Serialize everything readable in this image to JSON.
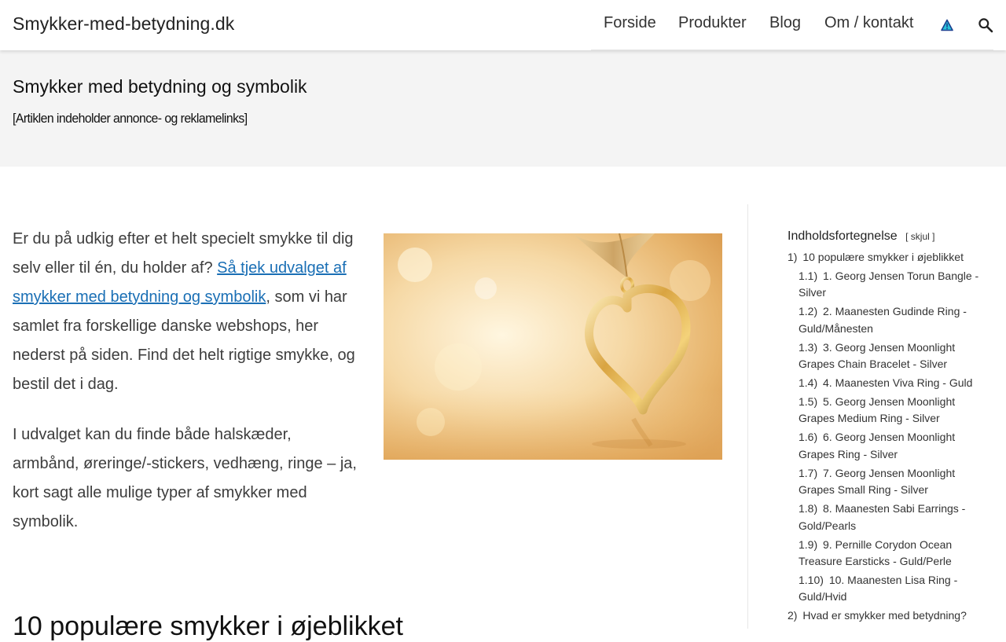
{
  "header": {
    "site_title": "Smykker-med-betydning.dk",
    "nav": [
      {
        "label": "Forside"
      },
      {
        "label": "Produkter"
      },
      {
        "label": "Blog"
      },
      {
        "label": "Om / kontakt"
      }
    ],
    "icons": {
      "warning": "warning-triangle-icon",
      "search": "search-icon"
    }
  },
  "hero": {
    "title": "Smykker med betydning og symbolik",
    "disclaimer": "[Artiklen indeholder annonce- og reklamelinks]"
  },
  "content": {
    "p1_before": "Er du på udkig efter et helt specielt smykke til dig selv eller til én, du holder af? ",
    "p1_link": "Så tjek udvalget af smykker med betydning og symbolik",
    "p1_after": ", som vi har samlet fra forskellige danske webshops, her nederst på siden. Find det helt rigtige smykke, og bestil det i dag.",
    "p2": "I udvalget kan du finde både halskæder, armbånd, øreringe/-stickers, vedhæng, ringe – ja, kort sagt alle mulige typer af smykker med symbolik.",
    "section_heading": "10 populære smykker i øjeblikket"
  },
  "toc": {
    "title": "Indholdsfortegnelse",
    "toggle_open": "[",
    "toggle_label": "skjul",
    "toggle_close": "]",
    "items": [
      {
        "num": "1)",
        "text": "10 populære smykker i øjeblikket",
        "level": 1
      },
      {
        "num": "1.1)",
        "text": "1. Georg Jensen Torun Bangle - Silver",
        "level": 2
      },
      {
        "num": "1.2)",
        "text": "2. Maanesten Gudinde Ring - Guld/Månesten",
        "level": 2
      },
      {
        "num": "1.3)",
        "text": "3. Georg Jensen Moonlight Grapes Chain Bracelet - Silver",
        "level": 2
      },
      {
        "num": "1.4)",
        "text": "4. Maanesten Viva Ring - Guld",
        "level": 2
      },
      {
        "num": "1.5)",
        "text": "5. Georg Jensen Moonlight Grapes Medium Ring - Silver",
        "level": 2
      },
      {
        "num": "1.6)",
        "text": "6. Georg Jensen Moonlight Grapes Ring - Silver",
        "level": 2
      },
      {
        "num": "1.7)",
        "text": "7. Georg Jensen Moonlight Grapes Small Ring - Silver",
        "level": 2
      },
      {
        "num": "1.8)",
        "text": "8. Maanesten Sabi Earrings - Gold/Pearls",
        "level": 2
      },
      {
        "num": "1.9)",
        "text": "9. Pernille Corydon Ocean Treasure Earsticks - Guld/Perle",
        "level": 2
      },
      {
        "num": "1.10)",
        "text": "10. Maanesten Lisa Ring - Guld/Hvid",
        "level": 2
      },
      {
        "num": "2)",
        "text": "Hvad er smykker med betydning?",
        "level": 1
      }
    ]
  },
  "colors": {
    "link": "#1a6fb5",
    "hero_bg": "#f4f4f4",
    "text": "#3d3d3d"
  }
}
